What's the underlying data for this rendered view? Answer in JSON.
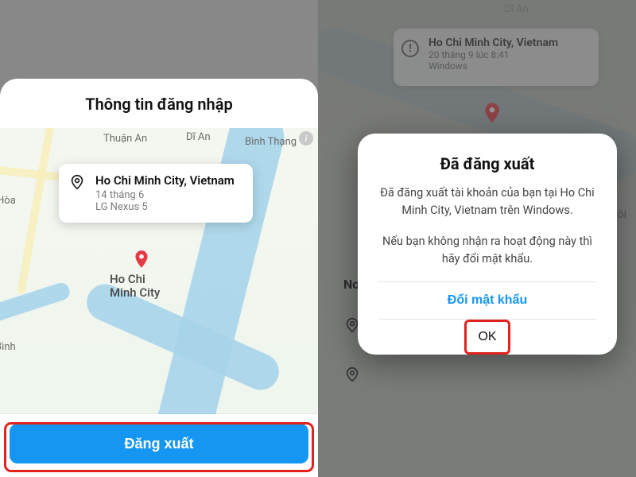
{
  "left": {
    "panel_title": "Thông tin đăng nhập",
    "map_labels": {
      "thuan_an": "Thuận An",
      "di_an": "Dĩ An",
      "binh_thang": "Bình Thạng",
      "hoa": "Hòa",
      "binh": "Bình",
      "big_city": "Ho Chi\nMinh City"
    },
    "session_card": {
      "location": "Ho Chi Minh City, Vietnam",
      "date": "14 tháng 6",
      "device": "LG Nexus 5"
    },
    "logout_label": "Đăng xuất"
  },
  "right": {
    "bg_card": {
      "location": "Ho Chi Minh City, Vietnam",
      "date": "20 tháng 9 lúc 8:41",
      "device": "Windows"
    },
    "section_label": "Nơi b",
    "partial_right_text": "tôi",
    "modal": {
      "title": "Đã đăng xuất",
      "para1": "Đã đăng xuất tài khoản của bạn tại Ho Chi Minh City, Vietnam trên Windows.",
      "para2": "Nếu bạn không nhận ra hoạt động này thì hãy đổi mật khẩu.",
      "change_password_label": "Đổi mật khẩu",
      "ok_label": "OK"
    }
  }
}
